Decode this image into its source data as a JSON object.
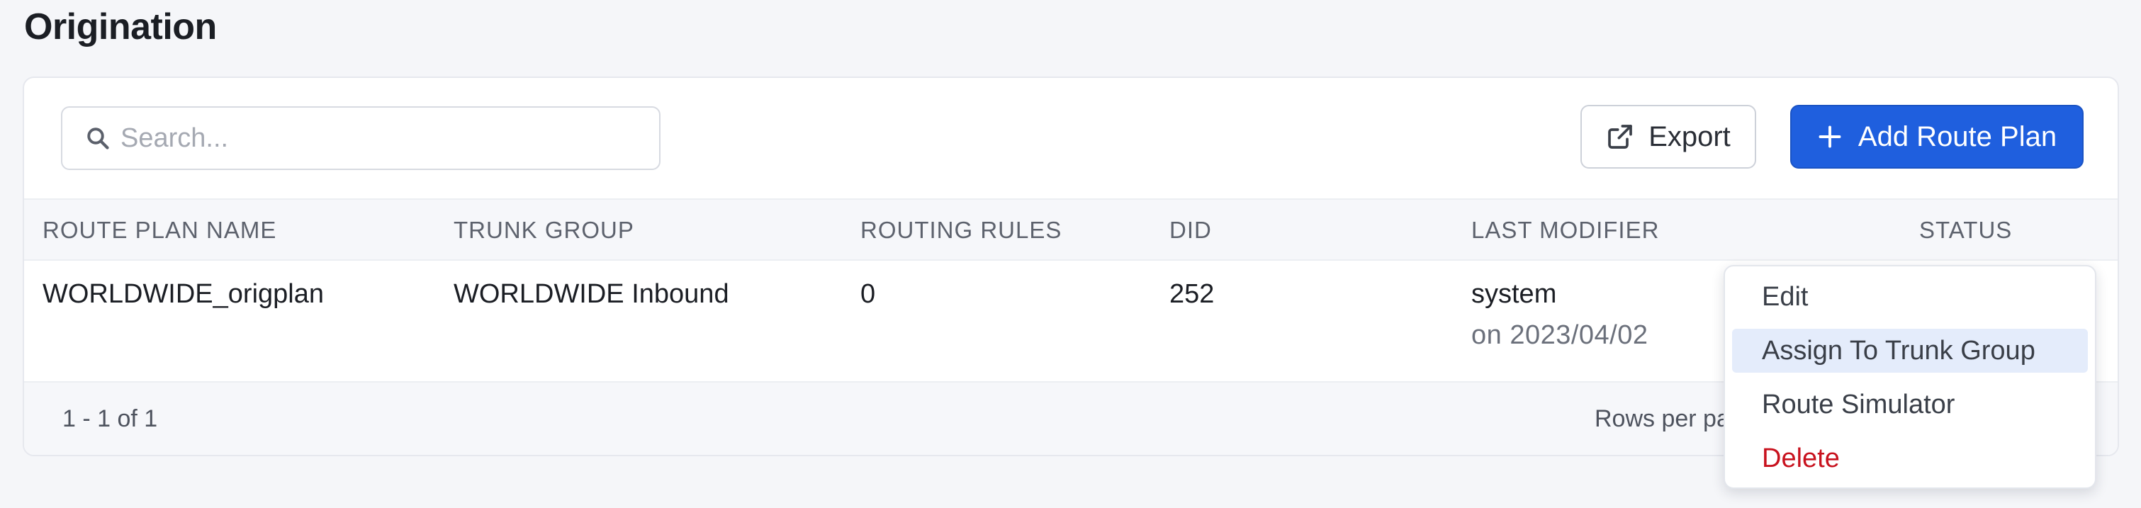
{
  "page": {
    "title": "Origination"
  },
  "toolbar": {
    "search_placeholder": "Search...",
    "export_label": "Export",
    "add_label": "Add Route Plan",
    "accent_color": "#1f5fde"
  },
  "table": {
    "columns": [
      "ROUTE PLAN NAME",
      "TRUNK GROUP",
      "ROUTING RULES",
      "DID",
      "LAST MODIFIER",
      "STATUS"
    ],
    "rows": [
      {
        "route_plan_name": "WORLDWIDE_origplan",
        "trunk_group": "WORLDWIDE Inbound",
        "routing_rules": "0",
        "did": "252",
        "last_modifier": "system",
        "modified_on": "on 2023/04/02"
      }
    ]
  },
  "footer": {
    "range": "1 - 1 of 1",
    "rows_per_page_label": "Rows per pa"
  },
  "context_menu": {
    "items": [
      {
        "label": "Edit"
      },
      {
        "label": "Assign To Trunk Group"
      },
      {
        "label": "Route Simulator"
      },
      {
        "label": "Delete"
      }
    ],
    "danger_color": "#c8121e"
  }
}
